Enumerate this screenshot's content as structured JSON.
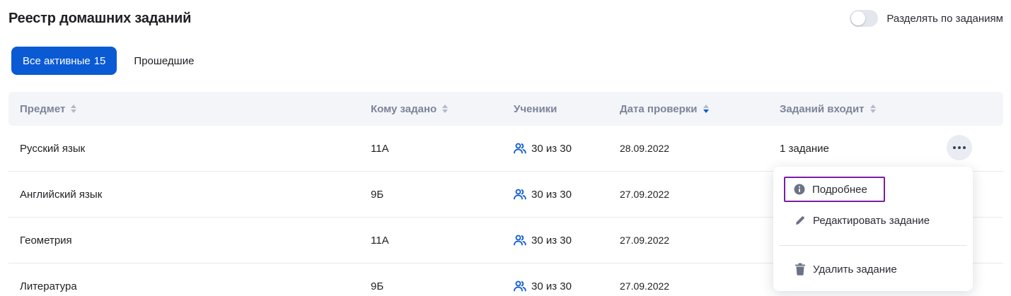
{
  "header": {
    "title": "Реестр домашних заданий",
    "toggle_label": "Разделять по заданиям",
    "toggle_on": false
  },
  "tabs": [
    {
      "label": "Все активные",
      "count": "15",
      "active": true
    },
    {
      "label": "Прошедшие",
      "count": "",
      "active": false
    }
  ],
  "table": {
    "columns": [
      {
        "label": "Предмет",
        "sort": "none"
      },
      {
        "label": "Кому задано",
        "sort": "none"
      },
      {
        "label": "Ученики",
        "sort": ""
      },
      {
        "label": "Дата проверки",
        "sort": "desc"
      },
      {
        "label": "Заданий входит",
        "sort": "none"
      }
    ],
    "rows": [
      {
        "subject": "Русский язык",
        "assigned_to": "11А",
        "students": "30 из 30",
        "check_date": "28.09.2022",
        "tasks": "1 задание"
      },
      {
        "subject": "Английский язык",
        "assigned_to": "9Б",
        "students": "30 из 30",
        "check_date": "27.09.2022",
        "tasks": ""
      },
      {
        "subject": "Геометрия",
        "assigned_to": "11А",
        "students": "30 из 30",
        "check_date": "27.09.2022",
        "tasks": ""
      },
      {
        "subject": "Литература",
        "assigned_to": "9Б",
        "students": "30 из 30",
        "check_date": "27.09.2022",
        "tasks": ""
      }
    ]
  },
  "context_menu": {
    "items": [
      {
        "label": "Подробнее",
        "icon": "info-icon"
      },
      {
        "label": "Редактировать задание",
        "icon": "pencil-icon"
      },
      {
        "label": "Удалить задание",
        "icon": "trash-icon"
      }
    ]
  },
  "colors": {
    "accent": "#0a5ad4",
    "focus_outline": "#7a1fa2",
    "header_text": "#7d8499"
  }
}
